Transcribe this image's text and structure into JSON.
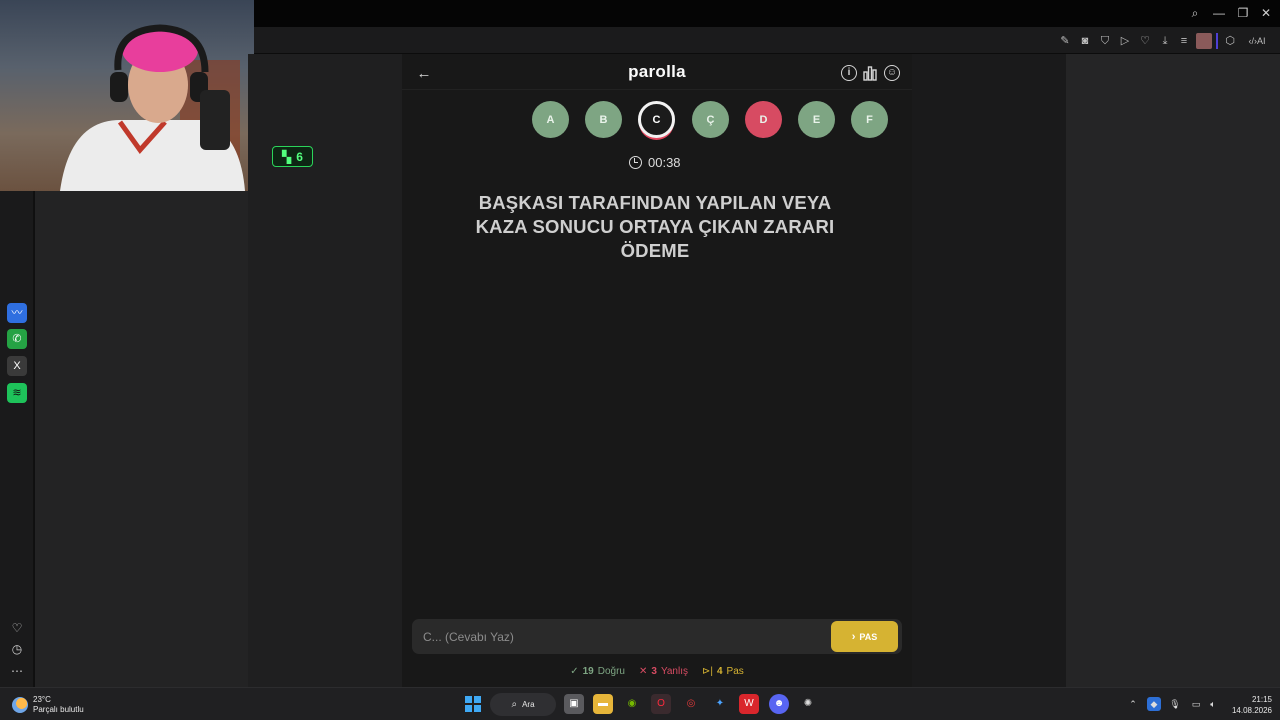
{
  "window": {
    "title_bar_icons": [
      "search-icon",
      "minimize-icon",
      "restore-icon",
      "close-icon"
    ],
    "toolbar_icons": [
      "edit-icon",
      "camera-icon",
      "shield-icon",
      "play-icon",
      "heart-icon",
      "download-icon",
      "menu-icon",
      "avatar-icon",
      "cube-icon",
      "ai-icon"
    ],
    "toolbar_ai_label": "AI"
  },
  "badge": {
    "icon": "kick-icon",
    "count": "6",
    "color": "#53ff7e"
  },
  "sidebar": {
    "apps": [
      {
        "name": "messenger",
        "glyph": "〰",
        "color": "#2f6fe0"
      },
      {
        "name": "whatsapp",
        "glyph": "✆",
        "color": "#25a244"
      },
      {
        "name": "x",
        "glyph": "X",
        "color": "#3a3a3a"
      },
      {
        "name": "spotify",
        "glyph": "≋",
        "color": "#1ec25a"
      }
    ],
    "bottom_icons": [
      "heart-icon",
      "history-icon",
      "more-icon"
    ]
  },
  "game": {
    "title": "parolla",
    "back_icon": "arrow-left-icon",
    "header_icons": [
      "info-icon",
      "stats-icon",
      "profile-icon"
    ],
    "letters": [
      {
        "label": "A",
        "state": "correct"
      },
      {
        "label": "B",
        "state": "correct"
      },
      {
        "label": "C",
        "state": "current"
      },
      {
        "label": "Ç",
        "state": "correct"
      },
      {
        "label": "D",
        "state": "wrong"
      },
      {
        "label": "E",
        "state": "correct"
      },
      {
        "label": "F",
        "state": "correct"
      }
    ],
    "timer": "00:38",
    "question_lines": [
      "BAŞKASI TARAFINDAN YAPILAN VEYA",
      "KAZA SONUCU ORTAYA ÇIKAN ZARARI",
      "ÖDEME"
    ],
    "answer_placeholder": "C... (Cevabı Yaz)",
    "pass_label": "PAS",
    "stats": {
      "correct_count": "19",
      "correct_label": "Doğru",
      "wrong_count": "3",
      "wrong_label": "Yanlış",
      "pass_count": "4",
      "pass_label": "Pas"
    },
    "colors": {
      "correct": "#7ea583",
      "wrong": "#d74b62",
      "pass": "#d6b332"
    }
  },
  "taskbar": {
    "weather_temp": "23°C",
    "weather_desc": "Parçalı bulutlu",
    "search_label": "Ara",
    "time": "21:15",
    "date": "14.08.2026"
  }
}
